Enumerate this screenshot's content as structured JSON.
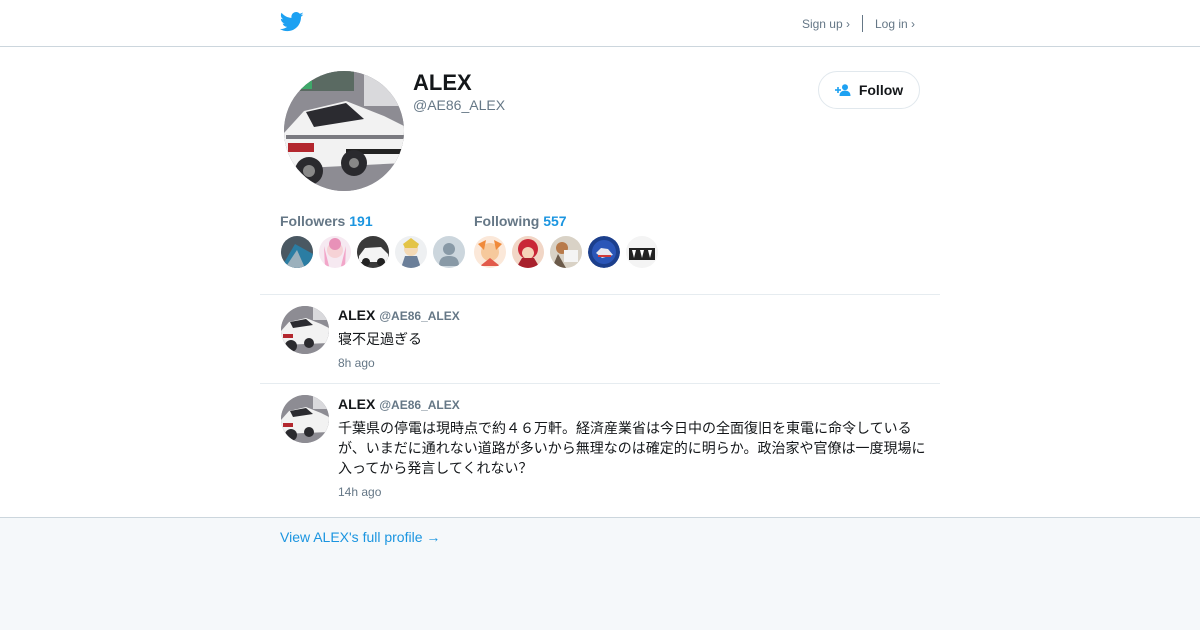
{
  "topbar": {
    "logo_icon": "twitter-bird-icon",
    "signup_label": "Sign up ›",
    "login_label": "Log in ›"
  },
  "profile": {
    "name": "ALEX",
    "handle": "@AE86_ALEX",
    "follow_label": "Follow",
    "followers_label": "Followers",
    "followers_count": "191",
    "following_label": "Following",
    "following_count": "557"
  },
  "tweets": [
    {
      "name": "ALEX",
      "handle": "@AE86_ALEX",
      "text": "寝不足過ぎる",
      "time": "8h ago"
    },
    {
      "name": "ALEX",
      "handle": "@AE86_ALEX",
      "text": "千葉県の停電は現時点で約４６万軒。経済産業省は今日中の全面復旧を東電に命令しているが、いまだに通れない道路が多いから無理なのは確定的に明らか。政治家や官僚は一度現場に入ってから発言してくれない？",
      "time": "14h ago"
    }
  ],
  "footer": {
    "full_profile_link": "View ALEX's full profile →"
  },
  "colors": {
    "brand_blue": "#1da1f2",
    "link_blue": "#1b95e0",
    "muted": "#657786",
    "footer_bg": "#f5f8fa"
  }
}
